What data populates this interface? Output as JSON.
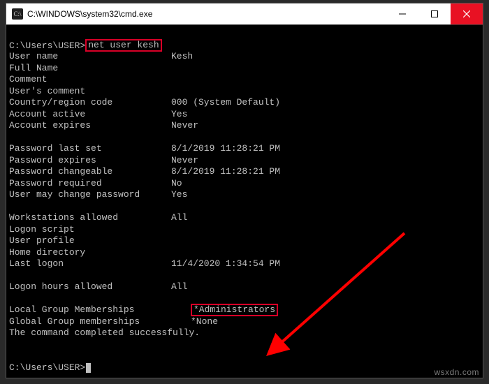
{
  "window": {
    "title": "C:\\WINDOWS\\system32\\cmd.exe"
  },
  "prompt_prefix": "C:\\Users\\USER>",
  "command": "net user kesh",
  "rows": [
    {
      "k": "User name",
      "v": "Kesh"
    },
    {
      "k": "Full Name",
      "v": ""
    },
    {
      "k": "Comment",
      "v": ""
    },
    {
      "k": "User's comment",
      "v": ""
    },
    {
      "k": "Country/region code",
      "v": "000 (System Default)"
    },
    {
      "k": "Account active",
      "v": "Yes"
    },
    {
      "k": "Account expires",
      "v": "Never"
    }
  ],
  "rows2": [
    {
      "k": "Password last set",
      "v": "8/1/2019 11:28:21 PM"
    },
    {
      "k": "Password expires",
      "v": "Never"
    },
    {
      "k": "Password changeable",
      "v": "8/1/2019 11:28:21 PM"
    },
    {
      "k": "Password required",
      "v": "No"
    },
    {
      "k": "User may change password",
      "v": "Yes"
    }
  ],
  "rows3": [
    {
      "k": "Workstations allowed",
      "v": "All"
    },
    {
      "k": "Logon script",
      "v": ""
    },
    {
      "k": "User profile",
      "v": ""
    },
    {
      "k": "Home directory",
      "v": ""
    },
    {
      "k": "Last logon",
      "v": "11/4/2020 1:34:54 PM"
    }
  ],
  "rows4": [
    {
      "k": "Logon hours allowed",
      "v": "All"
    }
  ],
  "group_local_label": "Local Group Memberships",
  "group_local_value": "*Administrators",
  "group_global_label": "Global Group memberships",
  "group_global_value": "*None",
  "completion": "The command completed successfully.",
  "watermark": "wsxdn.com",
  "colors": {
    "highlight": "#d80027",
    "arrow": "#ff0000"
  }
}
